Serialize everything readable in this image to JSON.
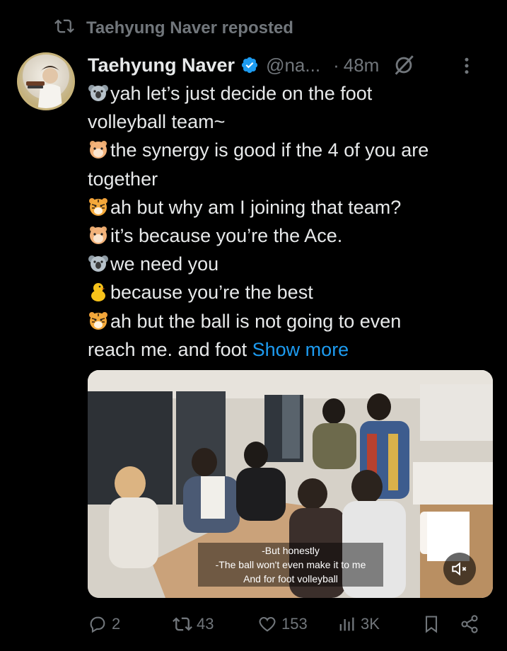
{
  "repost": {
    "label": "Taehyung Naver reposted",
    "icon": "repost-icon"
  },
  "post": {
    "author_name": "Taehyung Naver",
    "handle": "@na...",
    "separator": "·",
    "time": "48m",
    "lines": [
      {
        "emoji": "koala-emoji",
        "text": "yah let’s just decide on the foot"
      },
      {
        "emoji": "",
        "text": "volleyball team~"
      },
      {
        "emoji": "hamster-emoji",
        "text": "the synergy is good if the 4 of you are"
      },
      {
        "emoji": "",
        "text": "together"
      },
      {
        "emoji": "tiger-emoji",
        "text": "ah but why am I joining that team?"
      },
      {
        "emoji": "hamster-emoji",
        "text": "it’s because you’re the Ace."
      },
      {
        "emoji": "koala-emoji",
        "text": "we need you"
      },
      {
        "emoji": "chick-emoji",
        "text": "because you’re the best"
      },
      {
        "emoji": "tiger-emoji",
        "text": "ah but the ball is not going to even"
      },
      {
        "emoji": "",
        "text": "reach me. and foot "
      }
    ],
    "show_more": "Show more"
  },
  "media": {
    "subtitle_lines": [
      "-But honestly",
      "-The ball won't even make it to me",
      "And for foot volleyball"
    ]
  },
  "actions": {
    "replies": "2",
    "reposts": "43",
    "likes": "153",
    "views": "3K"
  },
  "colors": {
    "accent": "#1d9bf0",
    "muted": "#71767b",
    "text": "#e7e9ea",
    "background": "#000000"
  }
}
